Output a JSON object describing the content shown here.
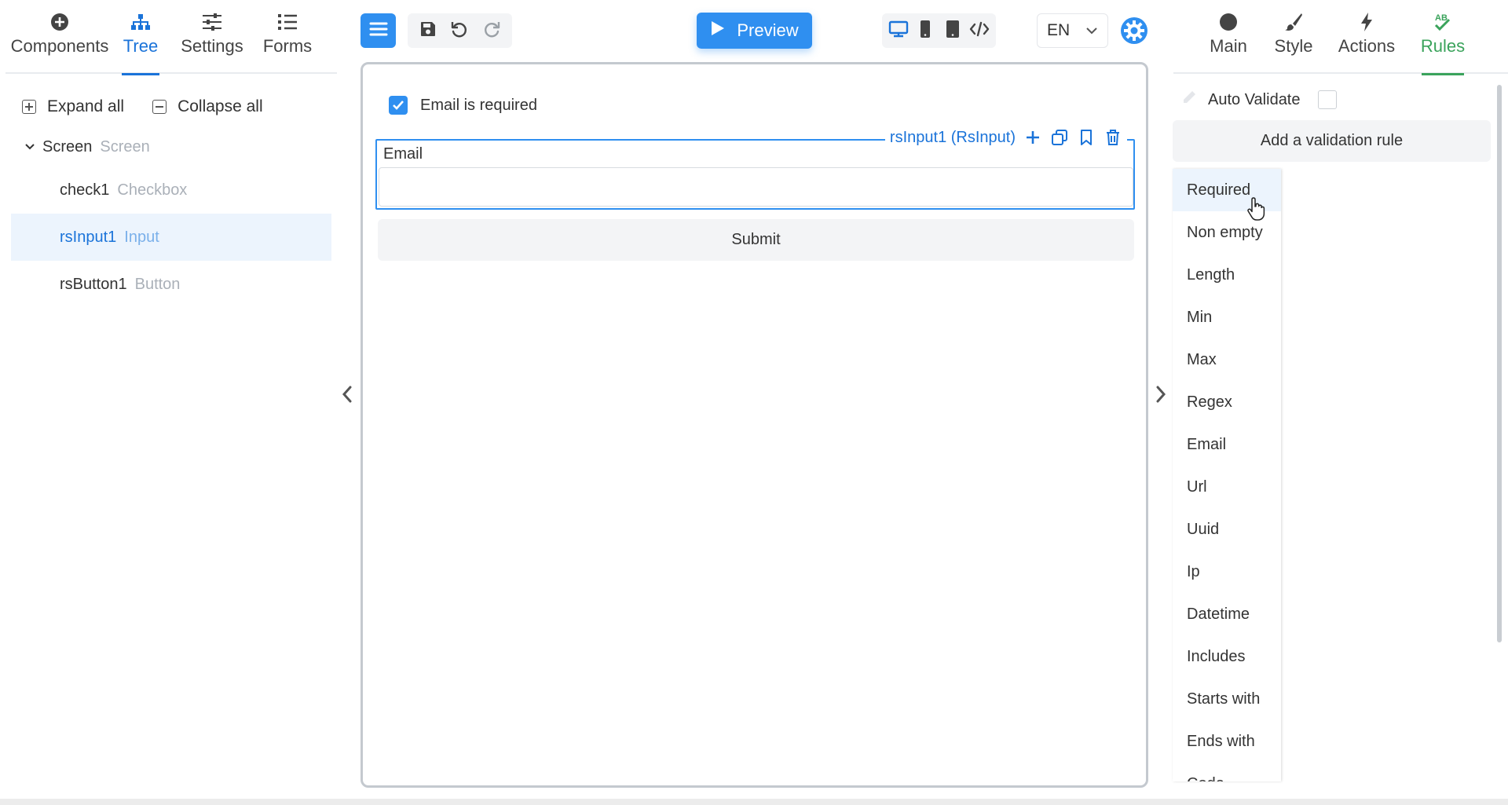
{
  "left_tabs": [
    {
      "label": "Components",
      "icon": "plus-circle-icon"
    },
    {
      "label": "Tree",
      "icon": "sitemap-icon",
      "active": true
    },
    {
      "label": "Settings",
      "icon": "sliders-icon"
    },
    {
      "label": "Forms",
      "icon": "list-icon"
    }
  ],
  "tree_actions": {
    "expand_all": "Expand all",
    "collapse_all": "Collapse all"
  },
  "tree": {
    "root": {
      "name": "Screen",
      "type": "Screen"
    },
    "children": [
      {
        "name": "check1",
        "type": "Checkbox"
      },
      {
        "name": "rsInput1",
        "type": "Input",
        "selected": true
      },
      {
        "name": "rsButton1",
        "type": "Button"
      }
    ]
  },
  "toolbar": {
    "preview_label": "Preview",
    "language": "EN"
  },
  "canvas": {
    "checkbox_label": "Email is required",
    "checkbox_checked": true,
    "selected_component_label": "rsInput1 (RsInput)",
    "field_label": "Email",
    "field_value": "",
    "submit_label": "Submit"
  },
  "right_tabs": [
    {
      "label": "Main",
      "icon": "circle-icon"
    },
    {
      "label": "Style",
      "icon": "brush-icon"
    },
    {
      "label": "Actions",
      "icon": "bolt-icon"
    },
    {
      "label": "Rules",
      "icon": "spellcheck-icon",
      "active": true
    }
  ],
  "rules_panel": {
    "auto_validate_label": "Auto Validate",
    "auto_validate_checked": false,
    "add_rule_label": "Add a validation rule",
    "rule_options": [
      "Required",
      "Non empty",
      "Length",
      "Min",
      "Max",
      "Regex",
      "Email",
      "Url",
      "Uuid",
      "Ip",
      "Datetime",
      "Includes",
      "Starts with",
      "Ends with",
      "Code"
    ],
    "hovered_option": "Required"
  },
  "colors": {
    "accent_blue": "#2f8ff0",
    "active_blue": "#1a73d9",
    "rules_green": "#3aa35b",
    "selected_row_bg": "#ecf4fd"
  }
}
